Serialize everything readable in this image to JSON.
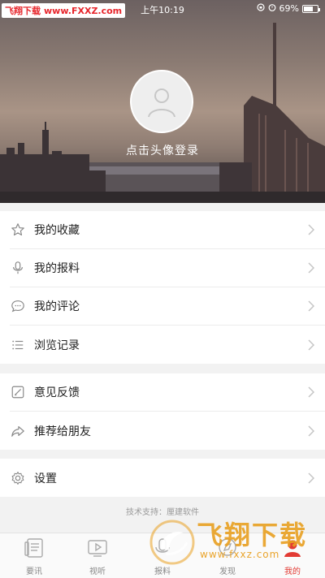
{
  "status_bar": {
    "watermark_left": "飞翔下载",
    "watermark_url": "www.FXXZ.com",
    "time": "上午10:19",
    "battery": "69%",
    "battery_level": 0.69
  },
  "profile": {
    "login_prompt": "点击头像登录"
  },
  "menu": {
    "group1": [
      {
        "label": "我的收藏",
        "icon": "star-icon"
      },
      {
        "label": "我的报料",
        "icon": "microphone-icon"
      },
      {
        "label": "我的评论",
        "icon": "comment-icon"
      },
      {
        "label": "浏览记录",
        "icon": "list-icon"
      }
    ],
    "group2": [
      {
        "label": "意见反馈",
        "icon": "edit-icon"
      },
      {
        "label": "推荐给朋友",
        "icon": "share-icon"
      }
    ],
    "group3": [
      {
        "label": "设置",
        "icon": "gear-icon"
      }
    ]
  },
  "footer": {
    "support": "技术支持：厘建软件"
  },
  "tabs": [
    {
      "label": "要讯",
      "icon": "news-icon"
    },
    {
      "label": "视听",
      "icon": "video-icon"
    },
    {
      "label": "报料",
      "icon": "report-icon"
    },
    {
      "label": "发现",
      "icon": "discover-icon"
    },
    {
      "label": "我的",
      "icon": "user-icon",
      "active": true
    }
  ],
  "watermark": {
    "title": "飞翔下载",
    "url": "www.fxxz.com"
  },
  "colors": {
    "accent": "#e23b34",
    "watermark": "#e9a021"
  }
}
